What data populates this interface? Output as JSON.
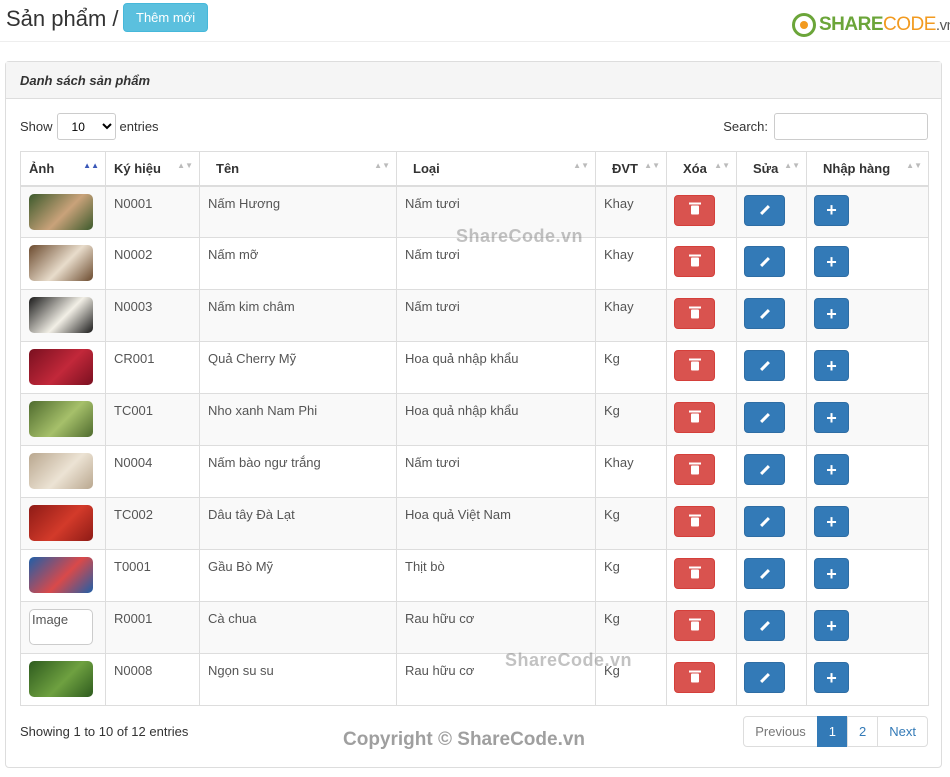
{
  "header": {
    "title": "Sản phẩm /",
    "add_button": "Thêm mới"
  },
  "logo": {
    "share": "SHARE",
    "code": "CODE",
    "vn": ".vn"
  },
  "panel": {
    "heading": "Danh sách sản phẩm"
  },
  "length": {
    "show": "Show",
    "value": "10",
    "entries": "entries"
  },
  "search": {
    "label": "Search:",
    "value": ""
  },
  "columns": [
    "Ảnh",
    "Ký hiệu",
    "Tên",
    "Loại",
    "ĐVT",
    "Xóa",
    "Sửa",
    "Nhập hàng"
  ],
  "rows": [
    {
      "code": "N0001",
      "name": "Nấm Hương",
      "type": "Nấm tươi",
      "unit": "Khay",
      "img": [
        "#3c5a2c",
        "#c9a27a"
      ]
    },
    {
      "code": "N0002",
      "name": "Nấm mỡ",
      "type": "Nấm tươi",
      "unit": "Khay",
      "img": [
        "#6b4a2e",
        "#e8dccb"
      ]
    },
    {
      "code": "N0003",
      "name": "Nấm kim châm",
      "type": "Nấm tươi",
      "unit": "Khay",
      "img": [
        "#1a1a1a",
        "#f2efe6"
      ]
    },
    {
      "code": "CR001",
      "name": "Quả Cherry Mỹ",
      "type": "Hoa quả nhập khẩu",
      "unit": "Kg",
      "img": [
        "#7a1020",
        "#c2283a"
      ]
    },
    {
      "code": "TC001",
      "name": "Nho xanh Nam Phi",
      "type": "Hoa quả nhập khẩu",
      "unit": "Kg",
      "img": [
        "#4f6b2e",
        "#a6c06a"
      ]
    },
    {
      "code": "N0004",
      "name": "Nấm bào ngư trắng",
      "type": "Nấm tươi",
      "unit": "Khay",
      "img": [
        "#b9a78f",
        "#ece3d4"
      ]
    },
    {
      "code": "TC002",
      "name": "Dâu tây Đà Lạt",
      "type": "Hoa quả Việt Nam",
      "unit": "Kg",
      "img": [
        "#8e1b16",
        "#d33a2a"
      ]
    },
    {
      "code": "T0001",
      "name": "Gầu Bò Mỹ",
      "type": "Thịt bò",
      "unit": "Kg",
      "img": [
        "#1f5fa8",
        "#d9494a"
      ]
    },
    {
      "code": "R0001",
      "name": "Cà chua",
      "type": "Rau hữu cơ",
      "unit": "Kg",
      "img": null,
      "img_alt": "Image"
    },
    {
      "code": "N0008",
      "name": "Ngọn su su",
      "type": "Rau hữu cơ",
      "unit": "Kg",
      "img": [
        "#2e5b1e",
        "#6ea040"
      ]
    }
  ],
  "info": "Showing 1 to 10 of 12 entries",
  "pager": {
    "previous": "Previous",
    "pages": [
      "1",
      "2"
    ],
    "next": "Next"
  },
  "watermarks": {
    "mark1": "ShareCode.vn",
    "mark2": "ShareCode.vn",
    "footer": "Copyright © ShareCode.vn"
  },
  "colors": {
    "info": "#5bc0de",
    "danger": "#d9534f",
    "primary": "#337ab7"
  }
}
